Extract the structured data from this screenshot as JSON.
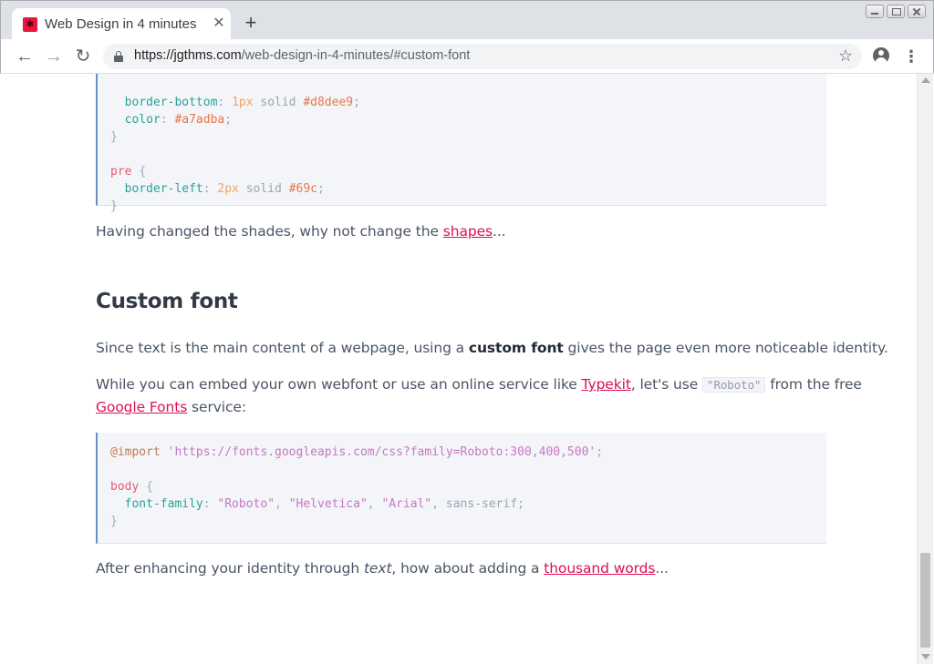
{
  "browser": {
    "tab_title": "Web Design in 4 minutes",
    "new_tab": "+",
    "url_host": "https://jgthms.com",
    "url_path": "/web-design-in-4-minutes/#custom-font"
  },
  "page": {
    "code1": {
      "line1_prop": "border-bottom",
      "line1_num": "1px",
      "line1_kw": "solid",
      "line1_hex": "#d8dee9",
      "line2_prop": "color",
      "line2_hex": "#a7adba",
      "close1": "}",
      "sel_pre": "pre",
      "open2": "{",
      "line3_prop": "border-left",
      "line3_num": "2px",
      "line3_kw": "solid",
      "line3_hex": "#69c",
      "close2": "}"
    },
    "para1": {
      "before": "Having changed the shades, why not change the ",
      "link": "shapes",
      "after": "..."
    },
    "heading": "Custom font",
    "para2": {
      "before": "Since text is the main content of a webpage, using a ",
      "bold": "custom font",
      "after": " gives the page even more noticeable identity."
    },
    "para3": {
      "before": "While you can embed your own webfont or use an online service like ",
      "link1": "Typekit",
      "middle": ", let's use ",
      "code": "\"Roboto\"",
      "after": " from the free",
      "link2": "Google Fonts",
      "end": " service:"
    },
    "code2": {
      "at": "@import",
      "url": "'https://fonts.googleapis.com/css?family=Roboto:300,400,500'",
      "semi": ";",
      "sel": "body",
      "open": "{",
      "prop": "font-family",
      "v1": "\"Roboto\"",
      "v2": "\"Helvetica\"",
      "v3": "\"Arial\"",
      "v4": "sans-serif",
      "close": "}"
    },
    "para4": {
      "before": "After enhancing your identity through ",
      "italic": "text",
      "middle": ", how about adding a ",
      "link": "thousand words",
      "after": "..."
    }
  }
}
